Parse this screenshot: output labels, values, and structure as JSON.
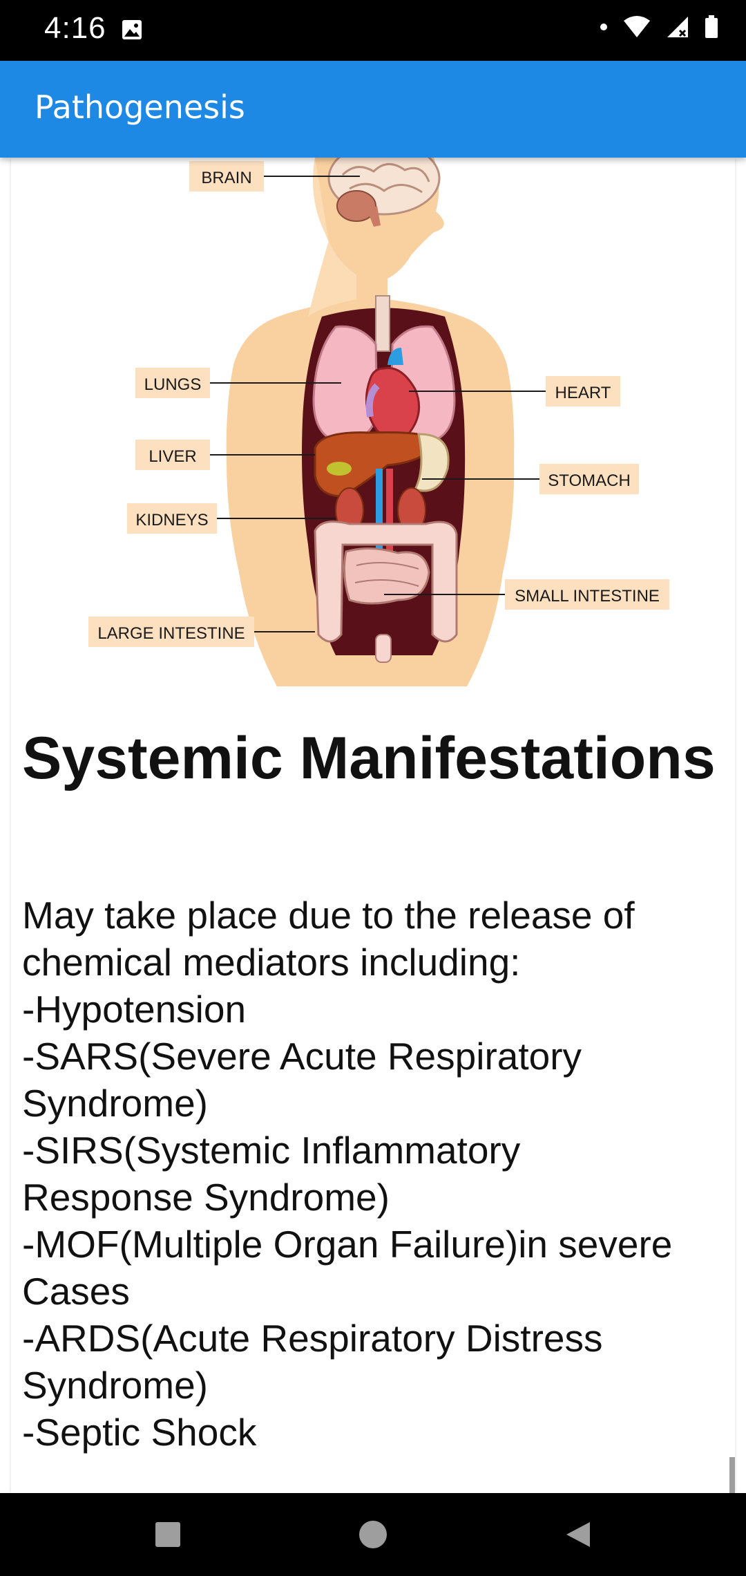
{
  "status_bar": {
    "time": "4:16",
    "icons": [
      "photo-icon",
      "dot-icon",
      "wifi-icon",
      "signal-icon",
      "battery-icon"
    ]
  },
  "app_bar": {
    "title": "Pathogenesis",
    "color": "#1e88e5"
  },
  "illustration": {
    "labels": {
      "brain": "BRAIN",
      "lungs": "LUNGS",
      "heart": "HEART",
      "liver": "LIVER",
      "stomach": "STOMACH",
      "kidneys": "KIDNEYS",
      "small_intestine": "SMALL INTESTINE",
      "large_intestine": "LARGE INTESTINE"
    },
    "label_bg_color": "#fde0c0"
  },
  "section": {
    "heading": "Systemic Manifestations",
    "lines": [
      "May take place due to the release of",
      "chemical mediators including:",
      "-Hypotension",
      "-SARS(Severe Acute Respiratory",
      "Syndrome)",
      "-SIRS(Systemic Inflammatory",
      "Response Syndrome)",
      "-MOF(Multiple Organ Failure)in severe",
      "Cases",
      "-ARDS(Acute Respiratory Distress",
      "Syndrome)",
      "-Septic Shock"
    ]
  },
  "nav_bar": {
    "buttons": [
      "recents-button",
      "home-button",
      "back-button"
    ]
  }
}
